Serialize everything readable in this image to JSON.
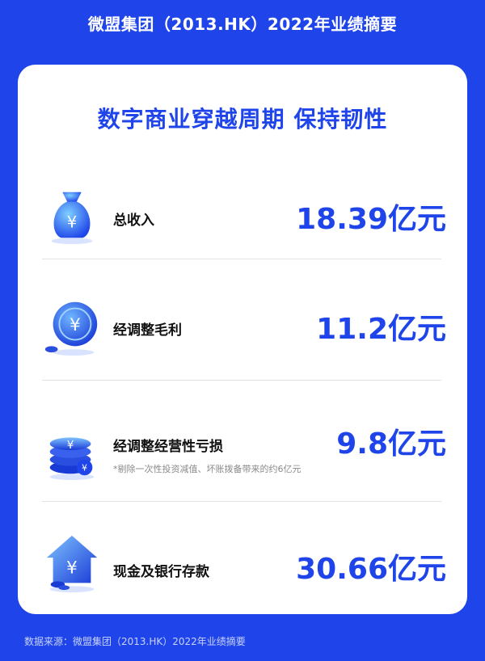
{
  "header": {
    "title": "微盟集团（2013.HK）2022年业绩摘要"
  },
  "card": {
    "subtitle": "数字商业穿越周期 保持韧性"
  },
  "metrics": [
    {
      "label": "总收入",
      "value": "18.39亿元",
      "icon": "money-bag-icon"
    },
    {
      "label": "经调整毛利",
      "value": "11.2亿元",
      "icon": "coin-icon"
    },
    {
      "label": "经调整经营性亏损",
      "value": "9.8亿元",
      "note": "*剔除一次性投资减值、坏账拨备带来的约6亿元",
      "icon": "coin-stack-icon"
    },
    {
      "label": "现金及银行存款",
      "value": "30.66亿元",
      "icon": "house-icon"
    }
  ],
  "footer": {
    "source": "数据来源：微盟集团（2013.HK）2022年业绩摘要"
  },
  "colors": {
    "brand_blue": "#1f45ea",
    "background": "#1f45ea",
    "card": "#ffffff"
  }
}
